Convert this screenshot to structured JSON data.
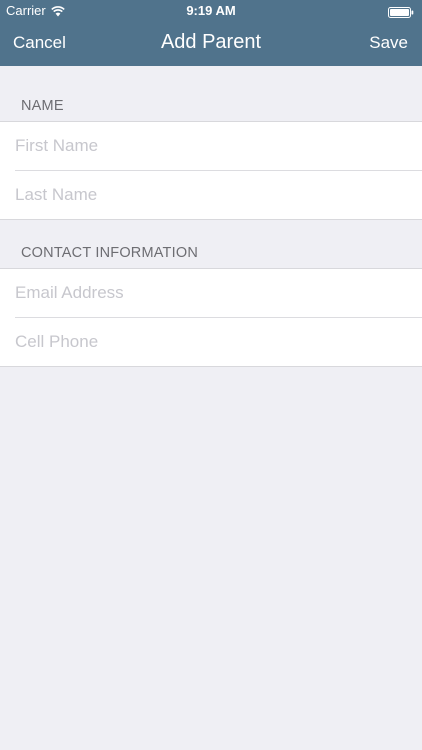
{
  "status_bar": {
    "carrier": "Carrier",
    "time": "9:19 AM"
  },
  "nav": {
    "cancel_label": "Cancel",
    "title": "Add Parent",
    "save_label": "Save"
  },
  "sections": {
    "name": {
      "header": "NAME",
      "first_name_placeholder": "First Name",
      "last_name_placeholder": "Last Name"
    },
    "contact": {
      "header": "CONTACT INFORMATION",
      "email_placeholder": "Email Address",
      "phone_placeholder": "Cell Phone"
    }
  },
  "colors": {
    "nav_background": "#50738c",
    "page_background": "#efeff4",
    "placeholder": "#c7c7cd"
  },
  "icons": [
    "wifi-icon",
    "battery-icon"
  ]
}
